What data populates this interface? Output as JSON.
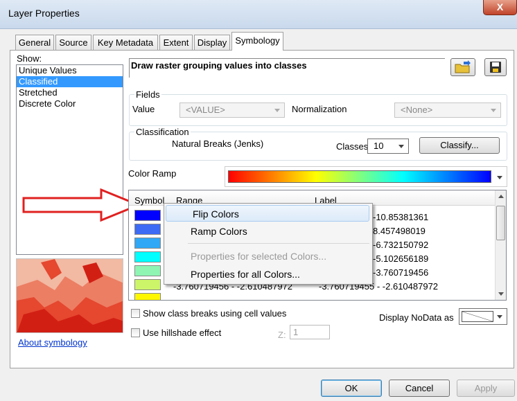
{
  "window": {
    "title": "Layer Properties",
    "close": "X"
  },
  "tabs": [
    "General",
    "Source",
    "Key Metadata",
    "Extent",
    "Display",
    "Symbology"
  ],
  "show": {
    "label": "Show:",
    "items": [
      "Unique Values",
      "Classified",
      "Stretched",
      "Discrete Color"
    ],
    "selected": "Classified"
  },
  "heading": "Draw raster grouping values into classes",
  "fields": {
    "label": "Fields",
    "value_label": "Value",
    "value": "<VALUE>",
    "normalization_label": "Normalization",
    "normalization": "<None>"
  },
  "classification": {
    "label": "Classification",
    "method": "Natural Breaks (Jenks)",
    "classes_label": "Classes",
    "classes": "10",
    "classify_button": "Classify..."
  },
  "color_ramp": {
    "label": "Color Ramp"
  },
  "table": {
    "headers": [
      "Symbol",
      "Range",
      "Label"
    ],
    "rows": [
      {
        "color": "#0000ff",
        "range": "",
        "label": "-10.85381361"
      },
      {
        "color": "#3d6bf5",
        "range": "",
        "label": "8.457498019"
      },
      {
        "color": "#30a8f5",
        "range": "",
        "label": "-6.732150792"
      },
      {
        "color": "#00ffff",
        "range": "",
        "label": "-5.102656189"
      },
      {
        "color": "#8ff5b3",
        "range": "",
        "label": "-3.760719456"
      },
      {
        "color": "#cdf56a",
        "range": "-3.760719456 - -2.610487972",
        "label": "-3.760719455 - -2.610487972"
      },
      {
        "color": "#fff700",
        "range": "",
        "label": ""
      }
    ]
  },
  "context_menu": {
    "items": [
      "Flip Colors",
      "Ramp Colors",
      "Properties for selected Colors...",
      "Properties for all Colors..."
    ]
  },
  "options": {
    "show_class_breaks": "Show class breaks using cell values",
    "use_hillshade": "Use hillshade effect",
    "z_label": "Z:",
    "z_value": "1",
    "display_nodata_label": "Display NoData as"
  },
  "about_link": "About symbology",
  "buttons": {
    "ok": "OK",
    "cancel": "Cancel",
    "apply": "Apply"
  }
}
